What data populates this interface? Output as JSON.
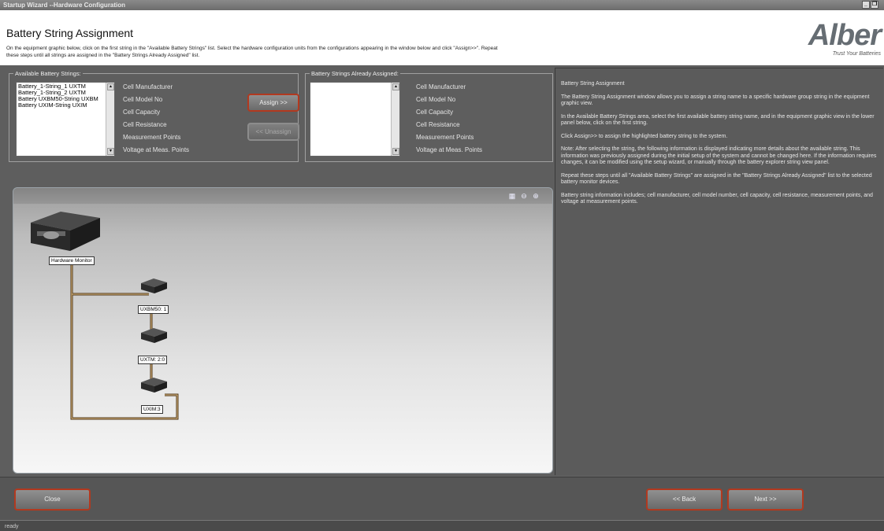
{
  "window": {
    "title": "Startup Wizard --Hardware Configuration",
    "controls": [
      "_",
      "❐",
      "✕"
    ]
  },
  "header": {
    "title": "Battery String Assignment",
    "instructions": "On the equipment graphic below, click on the first string in the \"Available Battery Strings\" list.  Select the hardware configuration units from the configurations appearing in the window below and click \"Assign>>\". Repeat these steps until all strings are assigned in the \"Battery Strings Already Assigned\" list.",
    "logo_text": "Alber",
    "logo_tagline": "Trust Your Batteries"
  },
  "available": {
    "legend": "Available Battery Strings:",
    "items": [
      "Battery_1-String_1 UXTM",
      "Battery_1-String_2 UXTM",
      "Battery UXBM50-String UXBM",
      "Battery UXIM-String UXIM"
    ],
    "fields": [
      "Cell Manufacturer",
      "Cell Model No",
      "Cell Capacity",
      "Cell Resistance",
      "Measurement Points",
      "Voltage at Meas. Points"
    ]
  },
  "assigned": {
    "legend": "Battery Strings Already Assigned:",
    "items": [],
    "fields": [
      "Cell Manufacturer",
      "Cell Model No",
      "Cell Capacity",
      "Cell Resistance",
      "Measurement Points",
      "Voltage at Meas. Points"
    ]
  },
  "buttons": {
    "assign": "Assign >>",
    "unassign": "<< Unassign",
    "close": "Close",
    "back": "<< Back",
    "next": "Next >>"
  },
  "graphic": {
    "toolbar_icons": [
      "fit-view-icon",
      "zoom-out-icon",
      "zoom-in-icon"
    ],
    "devices": {
      "monitor": "Hardware Monitor",
      "uxbm": "UXBM50: 1",
      "uxtm": "UXTM: 2:0",
      "uxim": "UXIM:3"
    }
  },
  "help": {
    "paragraphs": [
      "Battery String Assignment",
      "The Battery String Assignment window allows you to assign a string name to a specific hardware group string in the equipment graphic view.",
      "In the Available Battery Strings area, select the first available battery string name, and in the equipment graphic view in the lower panel below, click on the first string.",
      "Click Assign>> to assign the highlighted battery string to the system.",
      "Note: After selecting the string, the following information is displayed indicating more details about the available string. This information was previously assigned during the initial setup of the system and cannot be changed here. If the information requires changes, it can be modified using the setup wizard, or manually through the battery explorer string view panel.",
      "Repeat these steps until all \"Available Battery Strings\" are assigned in the \"Battery Strings Already Assigned\" list to the selected battery monitor devices.",
      "Battery string information includes; cell manufacturer, cell model number, cell capacity, cell resistance, measurement points, and voltage at measurement points."
    ]
  },
  "status": "ready",
  "colors": {
    "button_border": "#b2391f",
    "pane": "#5e5e5e",
    "wire": "#c8a060"
  }
}
